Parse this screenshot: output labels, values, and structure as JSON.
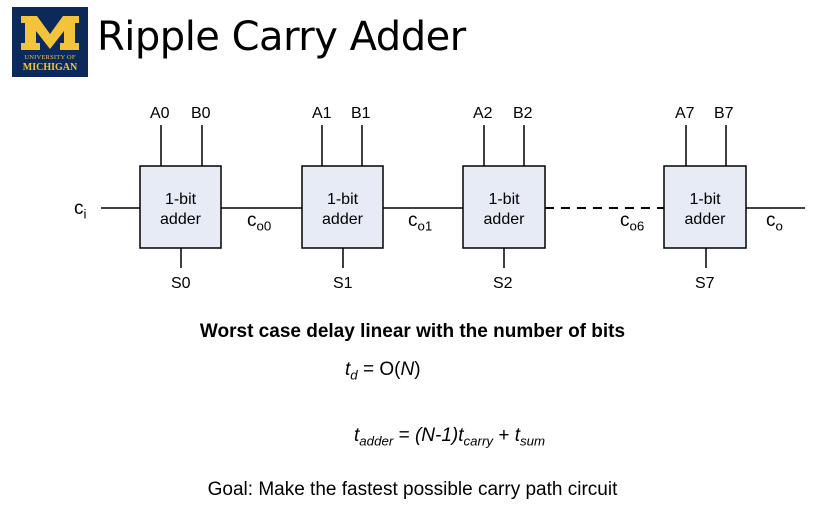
{
  "logo": {
    "initial": "M",
    "line1": "UNIVERSITY OF",
    "line2": "MICHIGAN"
  },
  "title": "Ripple Carry Adder",
  "adders": [
    {
      "label": [
        "1-bit",
        "adder"
      ],
      "a": "A0",
      "b": "B0",
      "s": "S0"
    },
    {
      "label": [
        "1-bit",
        "adder"
      ],
      "a": "A1",
      "b": "B1",
      "s": "S1"
    },
    {
      "label": [
        "1-bit",
        "adder"
      ],
      "a": "A2",
      "b": "B2",
      "s": "S2"
    },
    {
      "label": [
        "1-bit",
        "adder"
      ],
      "a": "A7",
      "b": "B7",
      "s": "S7"
    }
  ],
  "carries": {
    "ci": {
      "base": "c",
      "sub": "i"
    },
    "co0": {
      "base": "c",
      "sub": "o0"
    },
    "co1": {
      "base": "c",
      "sub": "o1"
    },
    "co6": {
      "base": "c",
      "sub": "o6"
    },
    "co": {
      "base": "c",
      "sub": "o"
    }
  },
  "caption_bold": "Worst case delay linear with the number of bits",
  "eq1": {
    "lhs": "t",
    "lhs_sub": "d",
    "eq": " = O(",
    "var": "N",
    "close": ")"
  },
  "eq2": {
    "lhs": "t",
    "lhs_sub": "adder",
    "eq": " = ",
    "n_minus_1": "(N-1)",
    "t1": "t",
    "t1_sub": "carry",
    "plus": " + ",
    "t2": "t",
    "t2_sub": "sum"
  },
  "goal": "Goal: Make the fastest possible carry path circuit"
}
